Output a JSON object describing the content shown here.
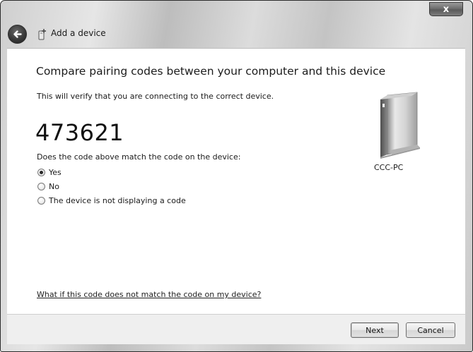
{
  "window": {
    "title": "Add a device",
    "close_label": "x"
  },
  "main": {
    "heading": "Compare pairing codes between your computer and this device",
    "subtext": "This will verify that you are connecting to the correct device.",
    "code": "473621",
    "question": "Does the code above match the code on the device:",
    "options": [
      {
        "label": "Yes",
        "checked": true
      },
      {
        "label": "No",
        "checked": false
      },
      {
        "label": "The device is not displaying a code",
        "checked": false
      }
    ],
    "device_name": "CCC-PC",
    "help_link": "What if this code does not match the code on my device?"
  },
  "footer": {
    "next_label": "Next",
    "cancel_label": "Cancel"
  },
  "icons": {
    "back": "back-arrow-icon",
    "title": "add-device-icon",
    "device": "computer-tower-icon",
    "close": "close-icon"
  }
}
